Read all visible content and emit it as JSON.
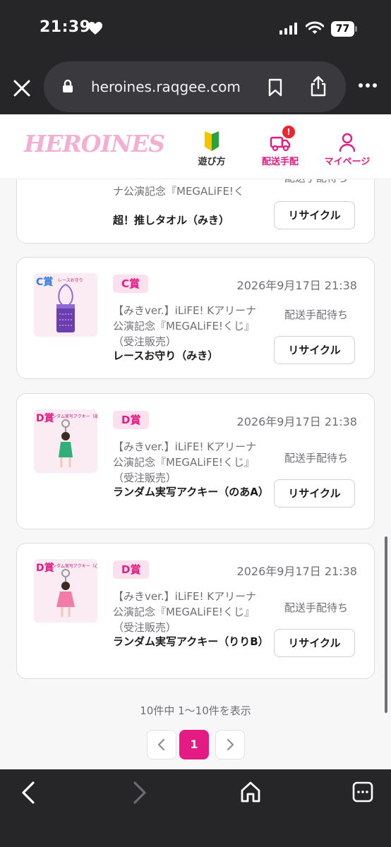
{
  "status_bar": {
    "time": "21:39",
    "battery": "77"
  },
  "browser": {
    "url": "heroines.raqgee.com"
  },
  "site_header": {
    "logo": "HEROINES",
    "nav": [
      {
        "label": "遊び方"
      },
      {
        "label": "配送手配",
        "badge": "!"
      },
      {
        "label": "マイページ"
      }
    ]
  },
  "cards": [
    {
      "event_name": "ナ公演記念『MEGALiFE!く",
      "item_name": "超！推しタオル（みき）",
      "ship_status": "配送手配待ち",
      "recycle_label": "リサイクル"
    },
    {
      "prize": "C賞",
      "thumb_prize": "C賞",
      "thumb_caption": "レースお守り",
      "date": "2026年9月17日 21:38",
      "event_name": "【みきver.】iLiFE! Kアリーナ公演記念『MEGALiFE!くじ』（受注販売）",
      "item_name": "レースお守り（みき）",
      "ship_status": "配送手配待ち",
      "recycle_label": "リサイクル"
    },
    {
      "prize": "D賞",
      "thumb_prize": "D賞",
      "thumb_caption": "ランダム実写アクキー（部屋のあA）",
      "date": "2026年9月17日 21:38",
      "event_name": "【みきver.】iLiFE! Kアリーナ公演記念『MEGALiFE!くじ』（受注販売）",
      "item_name": "ランダム実写アクキー（のあA）",
      "ship_status": "配送手配待ち",
      "recycle_label": "リサイクル"
    },
    {
      "prize": "D賞",
      "thumb_prize": "D賞",
      "thumb_caption": "ランダム実写アクキー（心花りりB）",
      "date": "2026年9月17日 21:38",
      "event_name": "【みきver.】iLiFE! Kアリーナ公演記念『MEGALiFE!くじ』（受注販売）",
      "item_name": "ランダム実写アクキー（りりB）",
      "ship_status": "配送手配待ち",
      "recycle_label": "リサイクル"
    }
  ],
  "pagination": {
    "info": "10件中 1〜10件を表示",
    "current": "1"
  },
  "colors": {
    "accent": "#e41b83",
    "badge_bg": "#fde0ee",
    "chrome_bg": "#262629",
    "logo": "#f4aed2"
  }
}
